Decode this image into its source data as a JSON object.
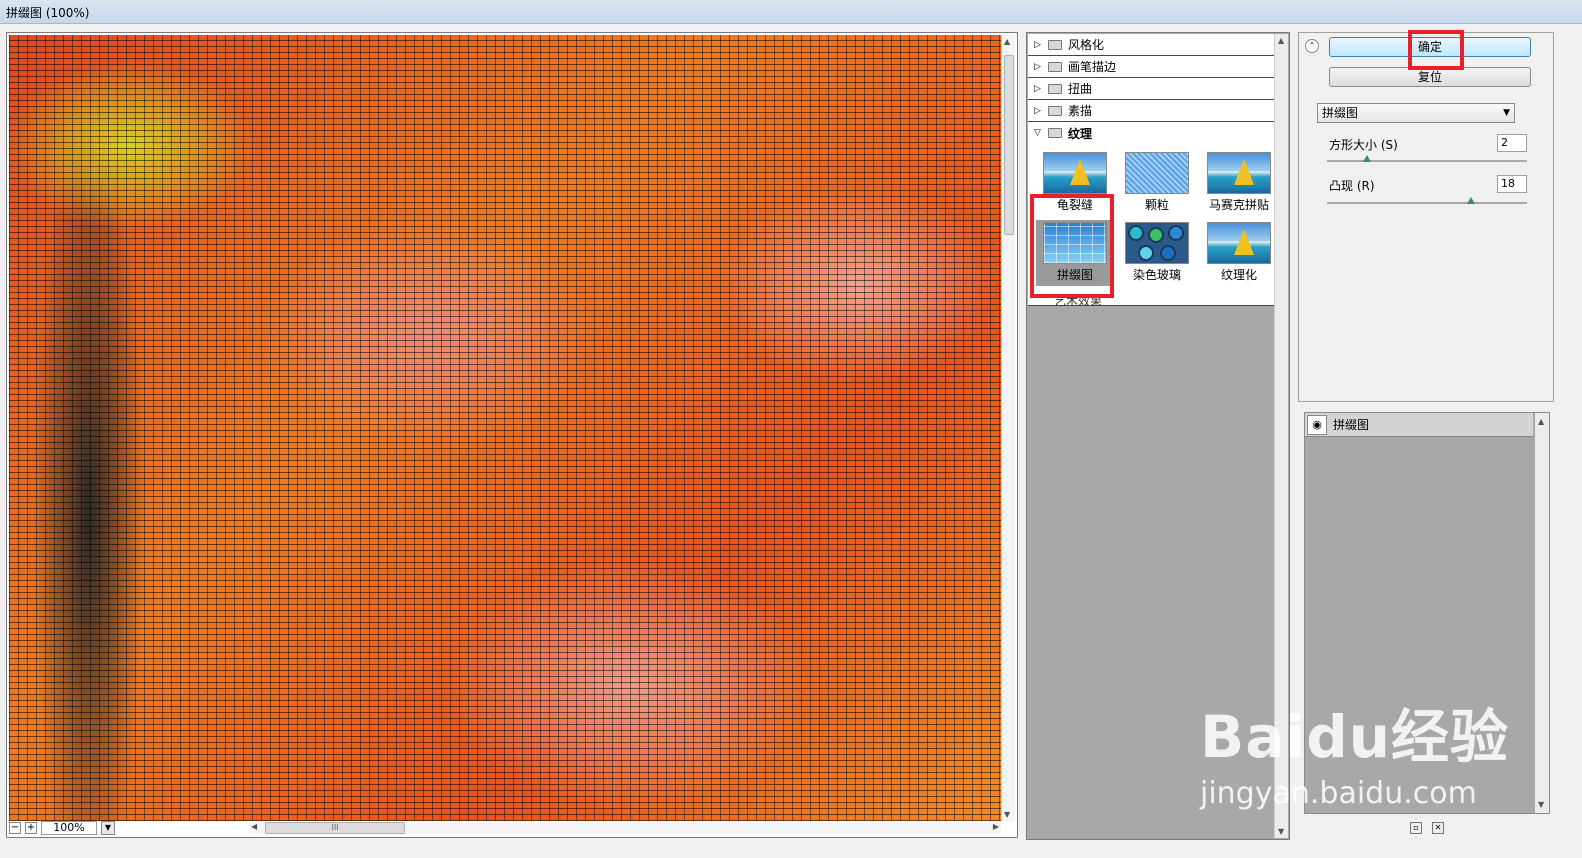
{
  "window": {
    "title": "拼缀图 (100%)"
  },
  "preview": {
    "zoom_out": "−",
    "zoom_in": "+",
    "zoom_value": "100%",
    "zoom_dropdown": "▼",
    "hscroll_grip": "III"
  },
  "gallery": {
    "folders": [
      {
        "label": "风格化",
        "expanded": false
      },
      {
        "label": "画笔描边",
        "expanded": false
      },
      {
        "label": "扭曲",
        "expanded": false
      },
      {
        "label": "素描",
        "expanded": false
      },
      {
        "label": "纹理",
        "expanded": true
      }
    ],
    "texture_filters": [
      {
        "label": "龟裂缝",
        "icon": "sailboat-thumb"
      },
      {
        "label": "颗粒",
        "icon": "grain-thumb"
      },
      {
        "label": "马赛克拼贴",
        "icon": "sailboat-thumb"
      },
      {
        "label": "拼缀图",
        "icon": "patchwork-thumb",
        "selected": true
      },
      {
        "label": "染色玻璃",
        "icon": "stained-glass-thumb"
      },
      {
        "label": "纹理化",
        "icon": "sailboat-thumb"
      }
    ],
    "next_folder": "艺术效果"
  },
  "settings": {
    "ok_label": "确定",
    "reset_label": "复位",
    "selected_filter": "拼缀图",
    "params": [
      {
        "label": "方形大小 (S)",
        "value": "2",
        "slider_fraction": 0.2
      },
      {
        "label": "凸现 (R)",
        "value": "18",
        "slider_fraction": 0.72
      }
    ]
  },
  "layers": {
    "items": [
      {
        "label": "拼缀图",
        "visible": true
      }
    ]
  },
  "watermark": {
    "logo": "Baidu经验",
    "url": "jingyan.baidu.com"
  },
  "colors": {
    "highlight_red": "#e8202a",
    "ok_button_blue": "#bee6fd"
  }
}
